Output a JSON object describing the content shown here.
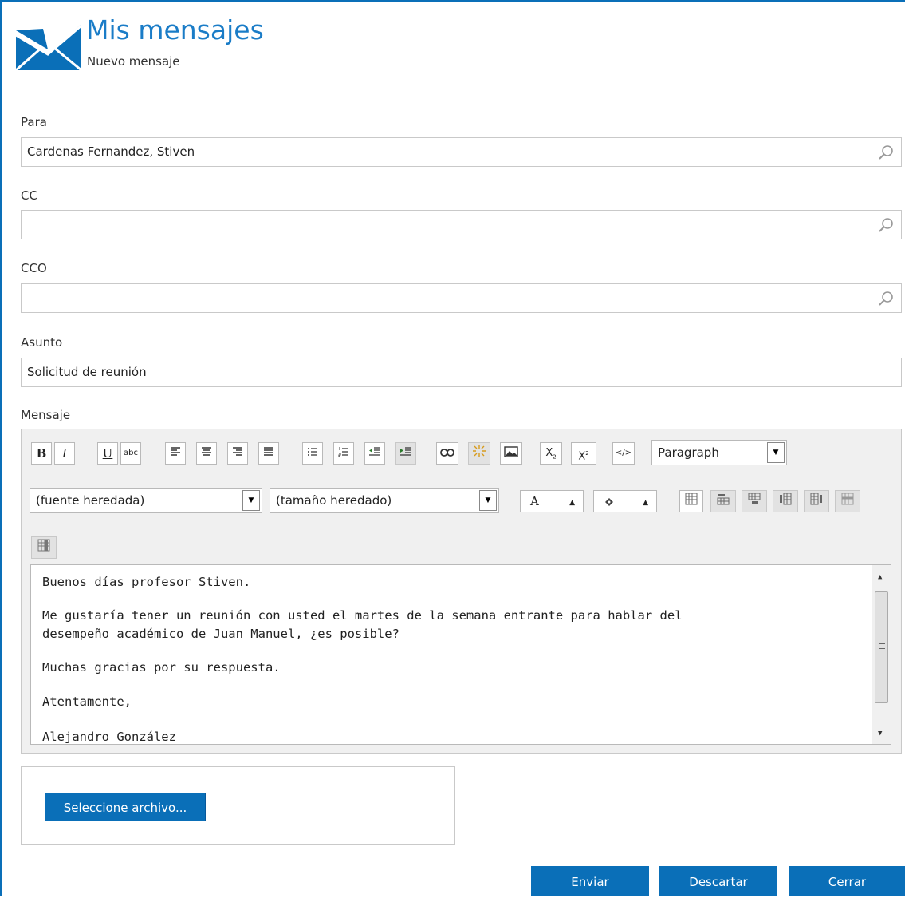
{
  "header": {
    "title": "Mis mensajes",
    "subtitle": "Nuevo mensaje"
  },
  "form": {
    "to_label": "Para",
    "to_value": "Cardenas Fernandez, Stiven",
    "cc_label": "CC",
    "cc_value": "",
    "bcc_label": "CCO",
    "bcc_value": "",
    "subject_label": "Asunto",
    "subject_value": "Solicitud de reunión",
    "message_label": "Mensaje"
  },
  "toolbar": {
    "bold": "B",
    "italic": "I",
    "underline": "U",
    "strike": "abc",
    "subscript": "X",
    "superscript": "X",
    "html": "</>",
    "format_select": "Paragraph",
    "font_select": "(fuente heredada)",
    "size_select": "(tamaño heredado)",
    "font_color": "A"
  },
  "message_body": [
    "Buenos días profesor Stiven.",
    "Me gustaría tener un reunión con usted el martes de la semana entrante para hablar del",
    "desempeño académico de Juan Manuel, ¿es posible?",
    "Muchas gracias por su respuesta.",
    "Atentamente,",
    "Alejandro González"
  ],
  "attachment": {
    "select_file_label": "Seleccione archivo..."
  },
  "actions": {
    "send": "Enviar",
    "discard": "Descartar",
    "close": "Cerrar"
  },
  "colors": {
    "accent": "#0a6fb8",
    "title": "#1a7cc7"
  }
}
